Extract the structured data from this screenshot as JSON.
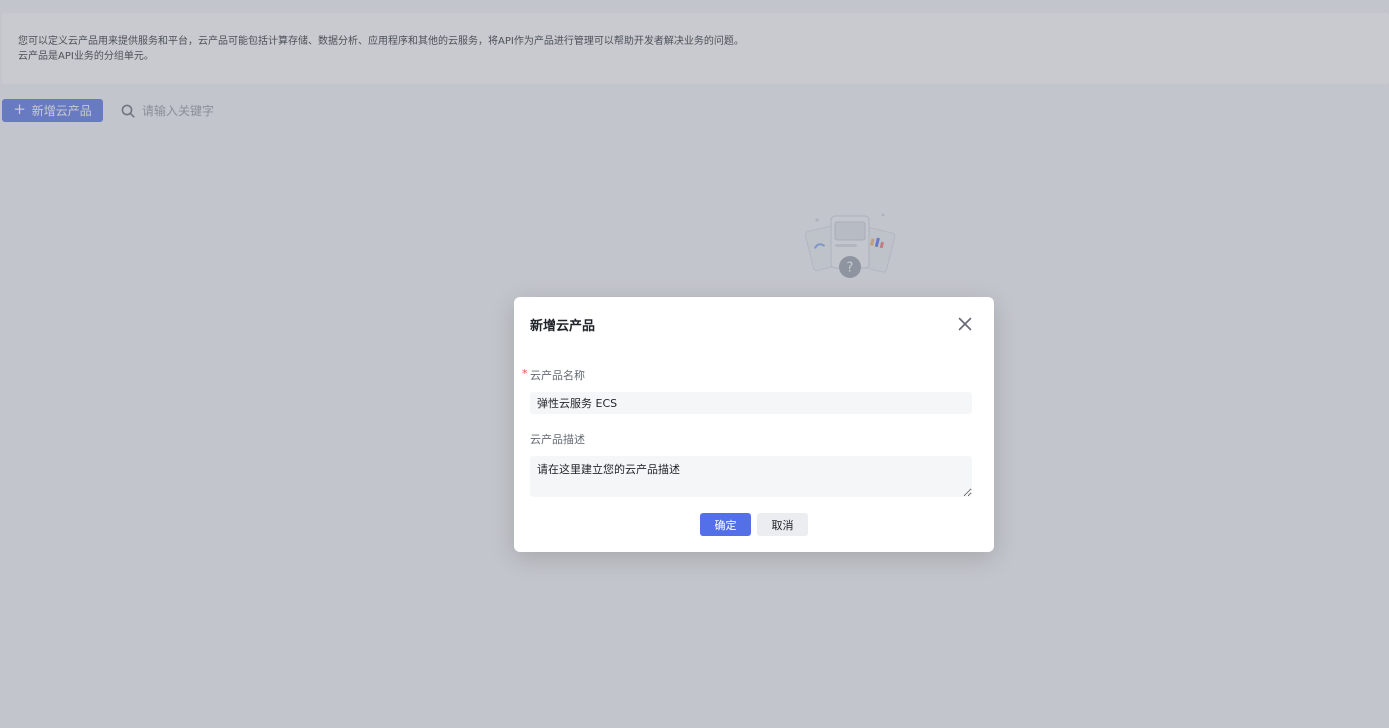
{
  "banner": {
    "line1": "您可以定义云产品用来提供服务和平台，云产品可能包括计算存储、数据分析、应用程序和其他的云服务，将API作为产品进行管理可以帮助开发者解决业务的问题。",
    "line2": "云产品是API业务的分组单元。"
  },
  "toolbar": {
    "add_label": "新增云产品",
    "search_placeholder": "请输入关键字"
  },
  "icons": {
    "add": "plus-icon",
    "search": "search-icon",
    "close": "close-icon",
    "empty": "empty-state-illustration"
  },
  "modal": {
    "title": "新增云产品",
    "name_label": "云产品名称",
    "name_required_mark": "*",
    "name_value": "弹性云服务 ECS",
    "desc_label": "云产品描述",
    "desc_value": "请在这里建立您的云产品描述",
    "ok_label": "确定",
    "cancel_label": "取消"
  },
  "colors": {
    "primary": "#5470e8",
    "required": "#f54a45"
  }
}
